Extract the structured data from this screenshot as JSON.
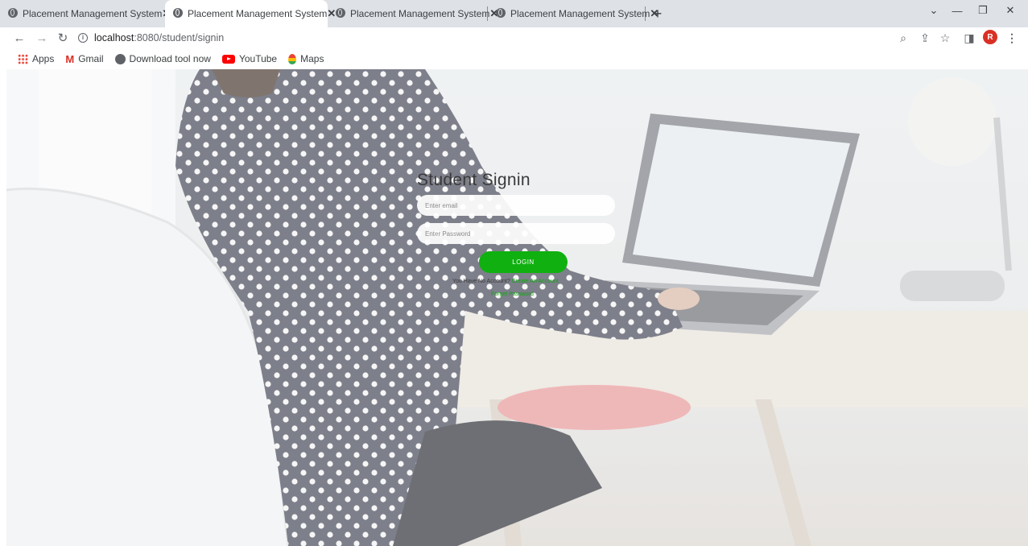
{
  "browser": {
    "tabs": [
      {
        "title": "Placement Management System",
        "close": "✕"
      },
      {
        "title": "Placement Management System",
        "close": "✕"
      },
      {
        "title": "Placement Management System",
        "close": "✕"
      },
      {
        "title": "Placement Management System",
        "close": "✕"
      }
    ],
    "new_tab": "+",
    "url_host": "localhost",
    "url_path": ":8080/student/signin",
    "profile_initial": "R",
    "bookmarks": [
      "Apps",
      "Gmail",
      "Download tool now",
      "YouTube",
      "Maps"
    ]
  },
  "page": {
    "title": "Student Signin",
    "email_placeholder": "Enter email",
    "password_placeholder": "Enter Password",
    "login_label": "LOGIN",
    "no_account_text": "You Have No Account?",
    "create_account_link": "Create An Account",
    "forgot_link": "Forget Password",
    "accent_color": "#10b010"
  }
}
